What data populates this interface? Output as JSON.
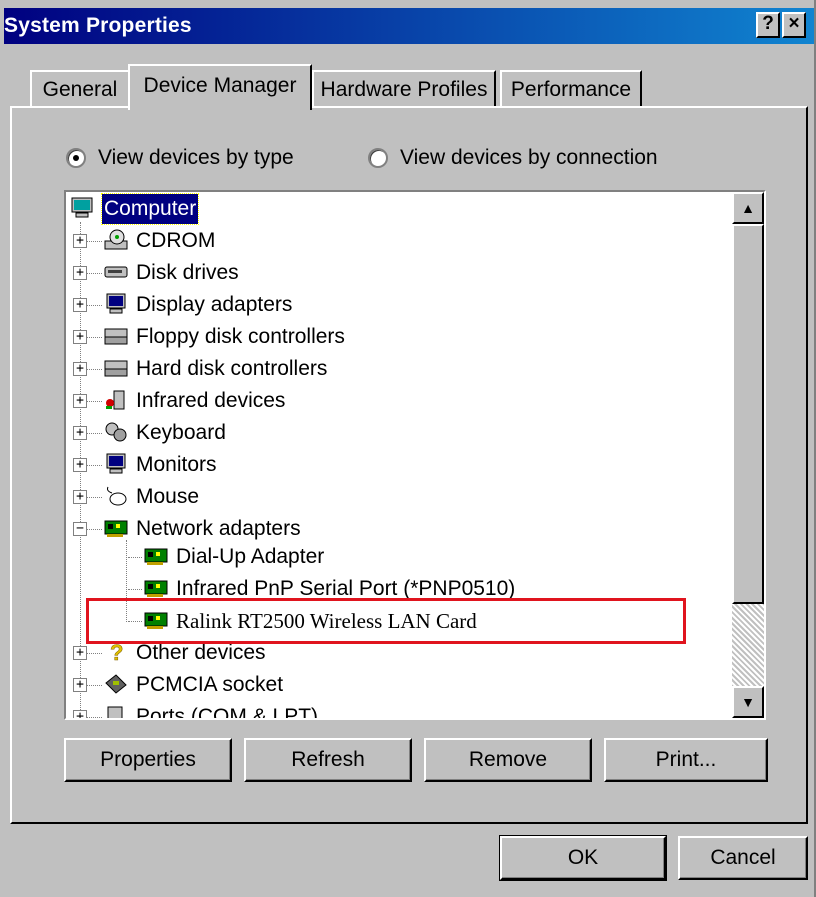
{
  "window": {
    "title": "System Properties",
    "help_label": "?",
    "close_label": "×"
  },
  "tabs": [
    {
      "label": "General"
    },
    {
      "label": "Device Manager"
    },
    {
      "label": "Hardware Profiles"
    },
    {
      "label": "Performance"
    }
  ],
  "view_options": {
    "by_type": "View devices by type",
    "by_connection": "View devices by connection",
    "selected": "by_type"
  },
  "tree": {
    "root": "Computer",
    "categories": [
      {
        "label": "CDROM",
        "icon": "cdrom-icon"
      },
      {
        "label": "Disk drives",
        "icon": "disk-drive-icon"
      },
      {
        "label": "Display adapters",
        "icon": "display-adapter-icon"
      },
      {
        "label": "Floppy disk controllers",
        "icon": "floppy-controller-icon"
      },
      {
        "label": "Hard disk controllers",
        "icon": "hard-disk-controller-icon"
      },
      {
        "label": "Infrared devices",
        "icon": "infrared-icon"
      },
      {
        "label": "Keyboard",
        "icon": "keyboard-icon"
      },
      {
        "label": "Monitors",
        "icon": "monitor-icon"
      },
      {
        "label": "Mouse",
        "icon": "mouse-icon"
      },
      {
        "label": "Network adapters",
        "icon": "network-adapter-icon"
      }
    ],
    "network_children": [
      {
        "label": "Dial-Up Adapter"
      },
      {
        "label": "Infrared PnP Serial Port (*PNP0510)"
      },
      {
        "label": "Ralink RT2500 Wireless LAN Card"
      }
    ],
    "after": [
      {
        "label": "Other devices",
        "icon": "question-icon"
      },
      {
        "label": "PCMCIA socket",
        "icon": "pcmcia-icon"
      },
      {
        "label": "Ports (COM & LPT)",
        "icon": "port-icon"
      }
    ]
  },
  "buttons": {
    "properties": "Properties",
    "refresh": "Refresh",
    "remove": "Remove",
    "print": "Print...",
    "ok": "OK",
    "cancel": "Cancel"
  },
  "colors": {
    "title_start": "#000080",
    "title_end": "#1084d0",
    "highlight_box": "#e0141e",
    "selection": "#000080"
  }
}
